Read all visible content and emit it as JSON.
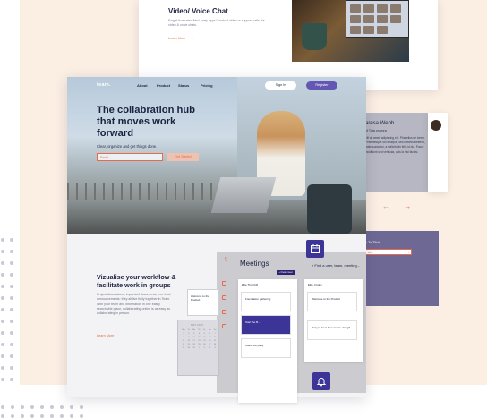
{
  "back_page": {
    "feature_title": "Video/ Voice Chat",
    "feature_desc": "Forget frustrated third-party apps.Conduct video or support calls via video & voice chats.",
    "learn_more": "Learn More"
  },
  "testimonial": {
    "name": "aresa Webb",
    "role": "of Tota on vora",
    "quote": "elit sit amet, adipiscing elit. Phasellus ue lorem. Pellentesque ubi tristique, sed lobortis eleifend, malesuada dui, a sollicitudin felis id dui. Fusce incididunt sed vehicula, quis la nisi facilisi."
  },
  "cta": {
    "title": "s To Tiida",
    "input_text": "am"
  },
  "nav": {
    "logo": "team.",
    "items": [
      "About",
      "Product",
      "Status",
      "Pricing"
    ],
    "signin": "Sign In",
    "register": "Register"
  },
  "hero": {
    "headline": "The collabration hub that moves work forward",
    "subtitle": "Clear, organize and get things done.",
    "email_placeholder": "Email",
    "get_started": "Get Started"
  },
  "section": {
    "title": "Vizualise your workflow & facilitate work in groups",
    "body": "Project discussions, important documents, free food announcements: they all live tidily together in Team. With your team and information in one easily searchable place, collaborating online is as easy as collaborating in person.",
    "learn_more": "Learn More"
  },
  "mockup": {
    "logo": "t",
    "title": "Meetings",
    "add_button": "+ Create meet",
    "search": "Find a user, team, meeting...",
    "col1_label": "Ellie Thornhill",
    "col2_label": "Ellie, Friday",
    "cards": [
      "Foundation gathering",
      "Welcome to the Product",
      "Start the B...",
      "Did you hear how we are doing?",
      "Catch the party"
    ],
    "float_card": "Welcome to the Product",
    "calendar_month": "MAY 2019",
    "calendar_days": [
      "Mo",
      "Tu",
      "We",
      "Th",
      "Fr",
      "Sa",
      "Su"
    ]
  },
  "colors": {
    "accent": "#e96a4a",
    "brand": "#3c3597",
    "register": "#6457b3",
    "peach_bg": "#fbeee3",
    "purple_panel": "#6e6895"
  }
}
